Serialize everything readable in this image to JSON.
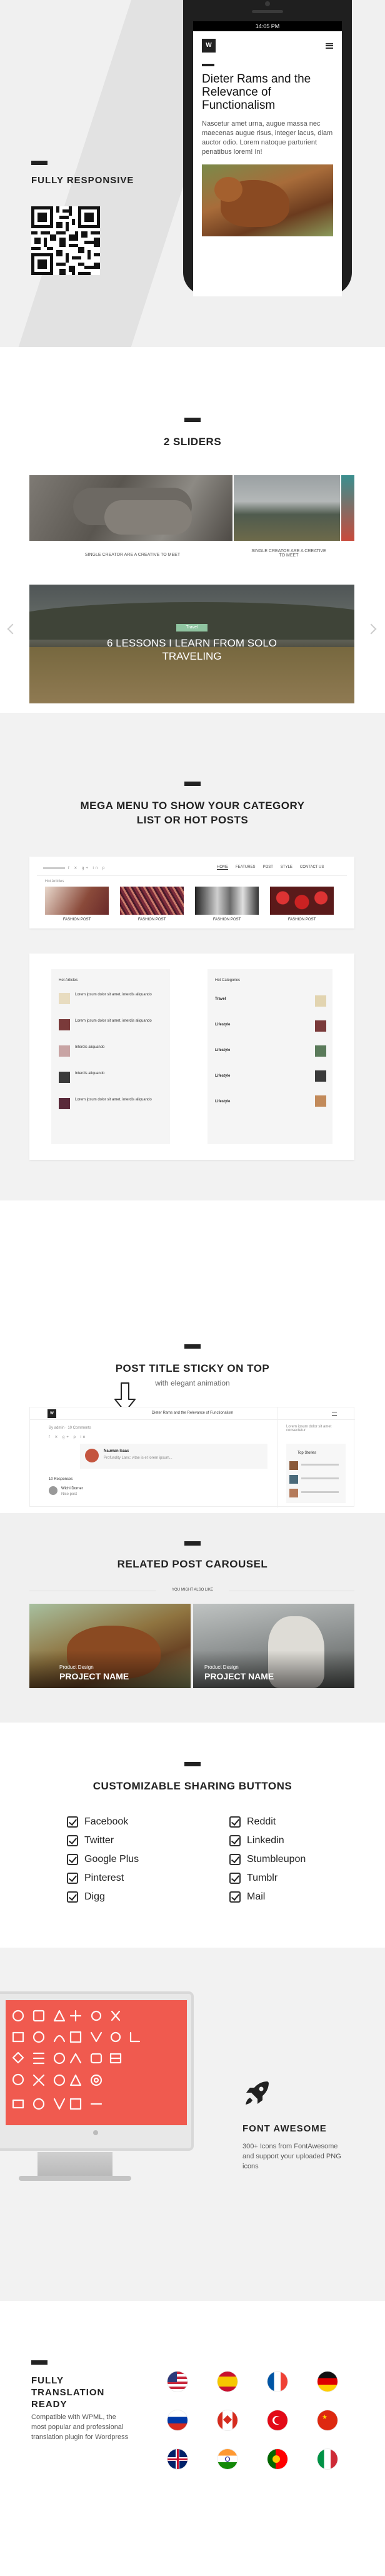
{
  "responsive": {
    "heading": "FULLY RESPONSIVE",
    "phone": {
      "time": "14:05 PM",
      "logo": "W",
      "title": "Dieter Rams and the Relevance of Functionalism",
      "text": "Nascetur amet urna, augue massa nec maecenas augue risus, integer lacus, diam auctor odio. Lorem natoque parturient penatibus lorem! In!"
    }
  },
  "sliders": {
    "heading": "2 SLIDERS",
    "slide1_caption_left": "SINGLE CREATOR ARE A CREATIVE TO MEET",
    "slide1_caption_right": "SINGLE CREATOR ARE A CREATIVE TO MEET",
    "slide2_category": "Travel",
    "slide2_title": "6 LESSONS I LEARN FROM SOLO TRAVELING"
  },
  "mega": {
    "heading": "MEGA MENU TO SHOW YOUR CATEGORY LIST OR HOT POSTS",
    "nav": [
      "Home",
      "Features",
      "Post",
      "Style",
      "Contact Us"
    ],
    "hot_label": "Hot Articles",
    "post_label": "FASHION POST",
    "hot_articles_title": "Hot Articles",
    "top_categories_title": "Hot Categories",
    "articles": [
      {
        "title": "Lorem ipsum dolor sit amet, interdis aliquando",
        "date": "2 days ago"
      },
      {
        "title": "Lorem ipsum dolor sit amet, interdis aliquando",
        "date": "2 days ago"
      },
      {
        "title": "Interdis aliquando",
        "date": "2 days ago"
      },
      {
        "title": "Interdis aliquando",
        "date": "2 days ago"
      },
      {
        "title": "Lorem ipsum dolor sit amet, interdis aliquando",
        "date": "2 days ago"
      }
    ],
    "categories": [
      {
        "name": "Travel",
        "sub": "5 Articles"
      },
      {
        "name": "Lifestyle",
        "sub": "5 Articles"
      },
      {
        "name": "Lifestyle",
        "sub": "5 Articles"
      },
      {
        "name": "Lifestyle",
        "sub": "5 Articles"
      },
      {
        "name": "Lifestyle",
        "sub": "5 Articles"
      }
    ]
  },
  "sticky": {
    "heading": "POST TITLE STICKY ON TOP",
    "subheading": "with elegant animation",
    "bar_title": "Dieter Rams and the Relevance of Functionalism",
    "meta": "By admin · 10 Comments",
    "author_name": "Nauman Isaac",
    "author_text": "Profundity Lanc: vitae is et lorem ipsum...",
    "comments_label": "10 Responses",
    "commenter": "Wichi Dorner",
    "comment_text": "Nice post",
    "top_stories": "Top Stories",
    "side_text": "Lorem ipsum dolor sit amet consectetur"
  },
  "related": {
    "heading": "RELATED POST CAROUSEL",
    "label": "YOU MIGHT ALSO LIKE",
    "projects": [
      {
        "category": "Product Design",
        "name": "PROJECT NAME"
      },
      {
        "category": "Product Design",
        "name": "PROJECT NAME"
      }
    ]
  },
  "sharing": {
    "heading": "CUSTOMIZABLE SHARING BUTTONS",
    "left": [
      "Facebook",
      "Twitter",
      "Google Plus",
      "Pinterest",
      "Digg"
    ],
    "right": [
      "Reddit",
      "Linkedin",
      "Stumbleupon",
      "Tumblr",
      "Mail"
    ]
  },
  "fontawesome": {
    "heading": "FONT AWESOME",
    "text": "300+ Icons from FontAwesome and support your uploaded PNG icons"
  },
  "translation": {
    "heading": "FULLY TRANSLATION READY",
    "text": "Compatible with WPML, the most popular and professional translation plugin for Wordpress"
  },
  "colors": {
    "accent": "#f05a4f",
    "dark": "#222222",
    "background": "#f0f0f0"
  }
}
